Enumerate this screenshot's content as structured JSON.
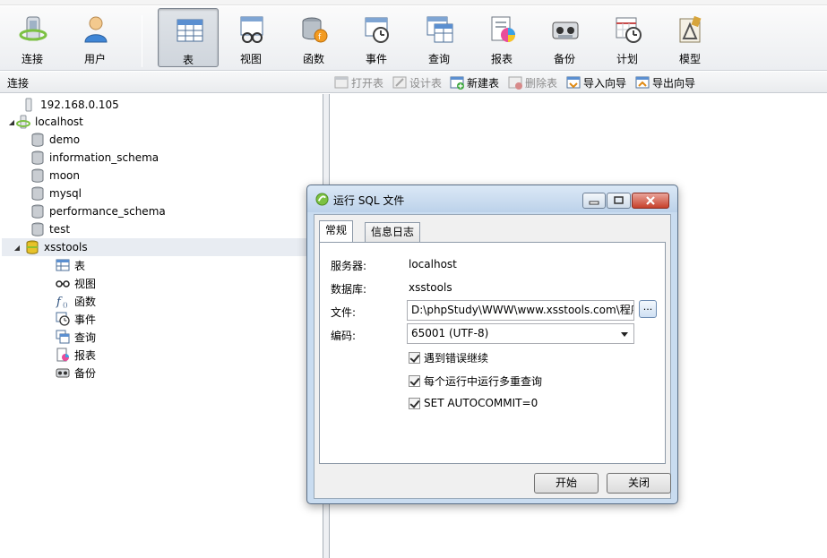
{
  "toolbar": {
    "items": [
      {
        "label": "连接",
        "icon": "connection-icon"
      },
      {
        "label": "用户",
        "icon": "user-icon"
      },
      {
        "label": "表",
        "icon": "table-icon",
        "active": true
      },
      {
        "label": "视图",
        "icon": "view-icon"
      },
      {
        "label": "函数",
        "icon": "function-icon"
      },
      {
        "label": "事件",
        "icon": "event-icon"
      },
      {
        "label": "查询",
        "icon": "query-icon"
      },
      {
        "label": "报表",
        "icon": "report-icon"
      },
      {
        "label": "备份",
        "icon": "backup-icon"
      },
      {
        "label": "计划",
        "icon": "schedule-icon"
      },
      {
        "label": "模型",
        "icon": "model-icon"
      }
    ]
  },
  "subbar": {
    "connection_label": "连接",
    "actions": [
      {
        "label": "打开表",
        "enabled": false
      },
      {
        "label": "设计表",
        "enabled": false
      },
      {
        "label": "新建表",
        "enabled": true
      },
      {
        "label": "删除表",
        "enabled": false
      },
      {
        "label": "导入向导",
        "enabled": true
      },
      {
        "label": "导出向导",
        "enabled": true
      }
    ]
  },
  "tree": {
    "connections": [
      {
        "label": "192.168.0.105"
      },
      {
        "label": "localhost"
      }
    ],
    "databases": [
      {
        "label": "demo"
      },
      {
        "label": "information_schema"
      },
      {
        "label": "moon"
      },
      {
        "label": "mysql"
      },
      {
        "label": "performance_schema"
      },
      {
        "label": "test"
      },
      {
        "label": "xsstools"
      }
    ],
    "objects": [
      {
        "label": "表"
      },
      {
        "label": "视图"
      },
      {
        "label": "函数"
      },
      {
        "label": "事件"
      },
      {
        "label": "查询"
      },
      {
        "label": "报表"
      },
      {
        "label": "备份"
      }
    ]
  },
  "dialog": {
    "title": "运行 SQL 文件",
    "tabs": [
      {
        "label": "常规",
        "active": true
      },
      {
        "label": "信息日志",
        "active": false
      }
    ],
    "server_label": "服务器:",
    "server_value": "localhost",
    "database_label": "数据库:",
    "database_value": "xsstools",
    "file_label": "文件:",
    "file_value": "D:\\phpStudy\\WWW\\www.xsstools.com\\程序",
    "browse_label": "...",
    "encoding_label": "编码:",
    "encoding_value": "65001 (UTF-8)",
    "options": [
      {
        "label": "遇到错误继续",
        "checked": true
      },
      {
        "label": "每个运行中运行多重查询",
        "checked": true
      },
      {
        "label": "SET AUTOCOMMIT=0",
        "checked": true
      }
    ],
    "start_label": "开始",
    "close_label": "关闭"
  },
  "colors": {
    "accent": "#3d7bd1",
    "db_yellow": "#e7c22a",
    "close_red": "#c7412c"
  }
}
